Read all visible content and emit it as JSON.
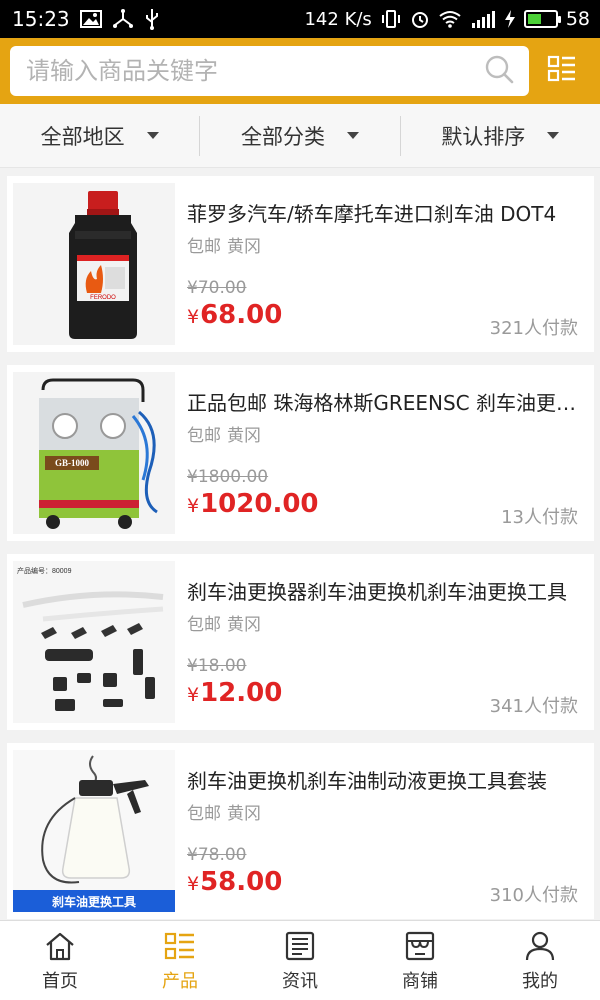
{
  "status_bar": {
    "time": "15:23",
    "net_speed": "142 K/s",
    "battery": "58",
    "battery_level": 0.58
  },
  "search": {
    "placeholder": "请输入商品关键字"
  },
  "filters": [
    {
      "label": "全部地区"
    },
    {
      "label": "全部分类"
    },
    {
      "label": "默认排序"
    }
  ],
  "products": [
    {
      "title": "菲罗多汽车/轿车摩托车进口刹车油 DOT4",
      "shipping": "包邮",
      "location": "黄冈",
      "old_price": "¥70.00",
      "currency": "¥",
      "price": "68.00",
      "sold": "321人付款",
      "image_label": "FERODO",
      "image": "brake-fluid-bottle"
    },
    {
      "title": "正品包邮 珠海格林斯GREENSC 刹车油更换机",
      "shipping": "包邮",
      "location": "黄冈",
      "old_price": "¥1800.00",
      "currency": "¥",
      "price": "1020.00",
      "sold": "13人付款",
      "image_label": "GB-1000",
      "image": "brake-fluid-machine"
    },
    {
      "title": "刹车油更换器刹车油更换机刹车油更换工具",
      "shipping": "包邮",
      "location": "黄冈",
      "old_price": "¥18.00",
      "currency": "¥",
      "price": "12.00",
      "sold": "341人付款",
      "image_label": "产品编号：80009",
      "image": "adapter-kit"
    },
    {
      "title": "刹车油更换机刹车油制动液更换工具套装",
      "shipping": "包邮",
      "location": "黄冈",
      "old_price": "¥78.00",
      "currency": "¥",
      "price": "58.00",
      "sold": "310人付款",
      "image_label": "刹车油更换工具",
      "image": "bleeder-tool"
    }
  ],
  "tabs": [
    {
      "label": "首页",
      "icon": "home-icon"
    },
    {
      "label": "产品",
      "icon": "list-icon",
      "active": true
    },
    {
      "label": "资讯",
      "icon": "news-icon"
    },
    {
      "label": "商铺",
      "icon": "shop-icon"
    },
    {
      "label": "我的",
      "icon": "user-icon"
    }
  ],
  "colors": {
    "accent": "#e5a412",
    "price": "#e02424"
  }
}
